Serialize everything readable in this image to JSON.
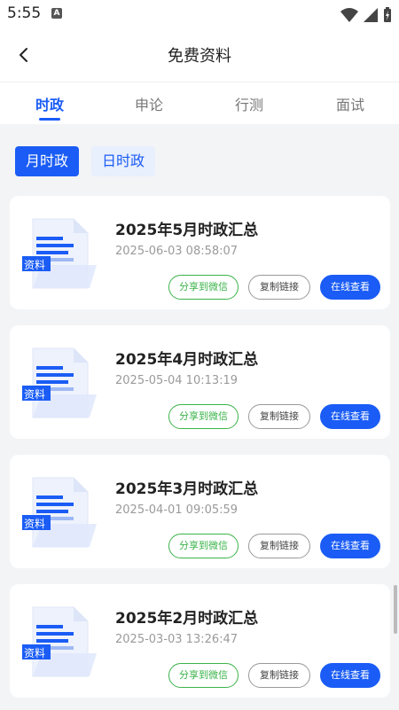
{
  "status": {
    "time": "5:55",
    "notification_letter": "A"
  },
  "header": {
    "title": "免费资料"
  },
  "tabs": [
    {
      "label": "时政",
      "active": true
    },
    {
      "label": "申论",
      "active": false
    },
    {
      "label": "行测",
      "active": false
    },
    {
      "label": "面试",
      "active": false
    }
  ],
  "filters": [
    {
      "label": "月时政",
      "active": true
    },
    {
      "label": "日时政",
      "active": false
    }
  ],
  "thumbnail_label": "资料",
  "buttons": {
    "share": "分享到微信",
    "copy": "复制链接",
    "view": "在线查看"
  },
  "items": [
    {
      "title": "2025年5月时政汇总",
      "date": "2025-06-03 08:58:07"
    },
    {
      "title": "2025年4月时政汇总",
      "date": "2025-05-04 10:13:19"
    },
    {
      "title": "2025年3月时政汇总",
      "date": "2025-04-01 09:05:59"
    },
    {
      "title": "2025年2月时政汇总",
      "date": "2025-03-03 13:26:47"
    }
  ],
  "colors": {
    "accent": "#1a5cf5",
    "share_green": "#3bb34a",
    "background": "#f3f4f6"
  }
}
